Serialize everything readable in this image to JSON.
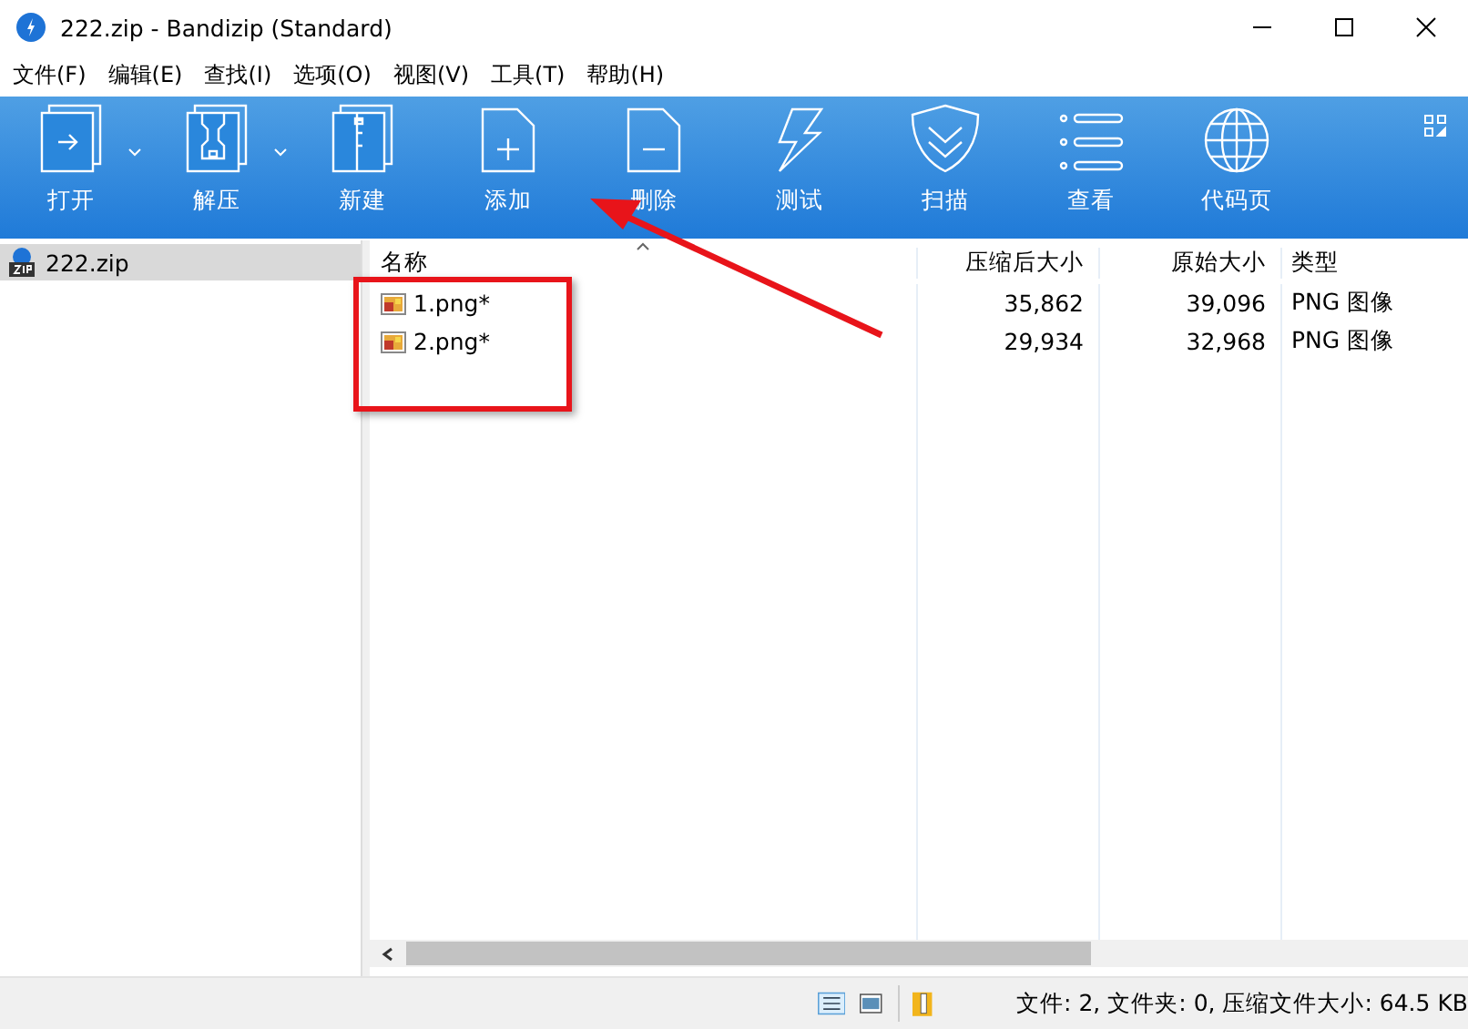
{
  "window": {
    "title": "222.zip - Bandizip (Standard)"
  },
  "menu": [
    "文件(F)",
    "编辑(E)",
    "查找(I)",
    "选项(O)",
    "视图(V)",
    "工具(T)",
    "帮助(H)"
  ],
  "toolbar": [
    {
      "kind": "open",
      "label": "打开",
      "dropdown": true
    },
    {
      "kind": "extract",
      "label": "解压",
      "dropdown": true
    },
    {
      "kind": "new",
      "label": "新建",
      "dropdown": false
    },
    {
      "kind": "add",
      "label": "添加",
      "dropdown": false
    },
    {
      "kind": "delete",
      "label": "删除",
      "dropdown": false
    },
    {
      "kind": "test",
      "label": "测试",
      "dropdown": false
    },
    {
      "kind": "scan",
      "label": "扫描",
      "dropdown": false
    },
    {
      "kind": "view",
      "label": "查看",
      "dropdown": false
    },
    {
      "kind": "codepage",
      "label": "代码页",
      "dropdown": false
    }
  ],
  "tree": [
    {
      "label": "222.zip",
      "selected": true
    }
  ],
  "table": {
    "columns": [
      "名称",
      "压缩后大小",
      "原始大小",
      "类型"
    ],
    "rows": [
      [
        "1.png*",
        "35,862",
        "39,096",
        "PNG 图像"
      ],
      [
        "2.png*",
        "29,934",
        "32,968",
        "PNG 图像"
      ]
    ]
  },
  "status_bar": {
    "text": "文件: 2, 文件夹: 0, 压缩文件大小: 64.5 KB"
  }
}
